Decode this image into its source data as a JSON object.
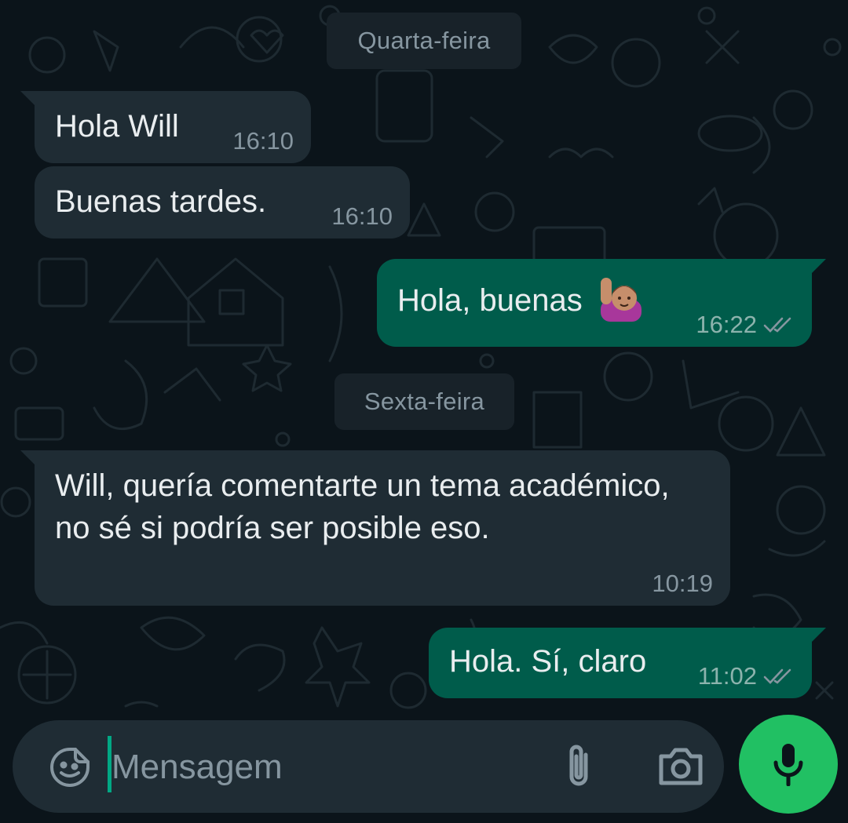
{
  "dates": {
    "first": "Quarta-feira",
    "second": "Sexta-feira"
  },
  "messages": [
    {
      "direction": "incoming",
      "text": "Hola Will",
      "time": "16:10"
    },
    {
      "direction": "incoming",
      "text": "Buenas tardes.",
      "time": "16:10"
    },
    {
      "direction": "outgoing",
      "text": "Hola, buenas",
      "emoji": "raising-hand-emoji",
      "time": "16:22",
      "status": "read"
    },
    {
      "direction": "incoming",
      "text": "Will, quería comentarte un tema académico, no sé si podría ser posible eso.",
      "time": "10:19"
    },
    {
      "direction": "outgoing",
      "text": "Hola. Sí, claro",
      "time": "11:02",
      "status": "read"
    }
  ],
  "composer": {
    "placeholder": "Mensagem",
    "value": ""
  },
  "icons": {
    "sticker": "sticker-icon",
    "attach": "paperclip-icon",
    "camera": "camera-icon",
    "send": "microphone-icon",
    "read_receipt": "double-check-icon"
  },
  "colors": {
    "background": "#0b141a",
    "incoming_bubble": "#1f2c34",
    "outgoing_bubble": "#005c4b",
    "accent": "#21c063",
    "read_tick": "#8696a0"
  }
}
